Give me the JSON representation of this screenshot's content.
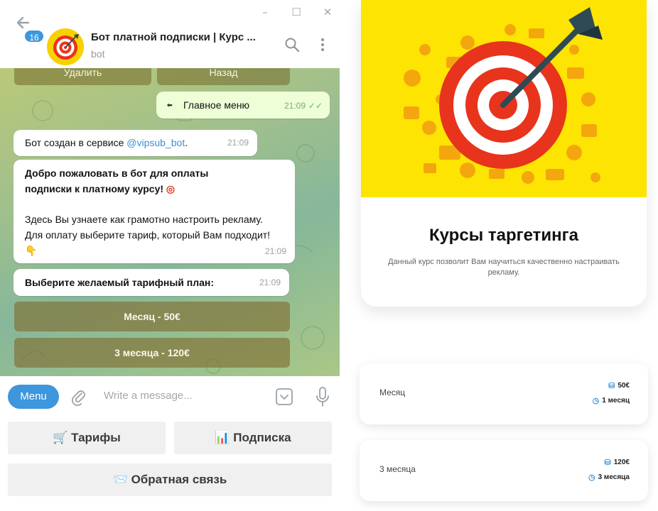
{
  "telegram": {
    "window_controls": {
      "minimize": "–",
      "maximize": "☐",
      "close": "✕"
    },
    "unread_badge": "16",
    "chat_title": "Бот платной подписки | Курс ...",
    "chat_subtitle": "bot",
    "top_buttons": [
      "Удалить",
      "Назад"
    ],
    "messages": {
      "outgoing_label": "Главное меню",
      "outgoing_time": "21:09",
      "created_prefix": "Бот создан в сервисе ",
      "created_link": "@vipsub_bot",
      "created_suffix": ".",
      "created_time": "21:09",
      "welcome_bold": "Добро пожаловать в бот для оплаты подписки к платному курсу!",
      "welcome_text": "Здесь Вы узнаете как грамотно настроить рекламу. Для оплату выберите тариф, который Вам подходит!",
      "welcome_time": "21:09",
      "choose_plan": "Выберите желаемый тарифный план:",
      "choose_time": "21:09"
    },
    "inline_buttons": [
      "Месяц - 50€",
      "3 месяца - 120€"
    ],
    "input": {
      "menu_label": "Menu",
      "placeholder": "Write a message..."
    },
    "reply_keyboard": {
      "tariffs": "Тарифы",
      "subscription": "Подписка",
      "feedback": "Обратная связь"
    }
  },
  "course": {
    "title": "Курсы таргетинга",
    "description": "Данный курс позволит Вам научиться качественно настраивать рекламу."
  },
  "plans": [
    {
      "name": "Месяц",
      "price": "50€",
      "duration": "1 месяц"
    },
    {
      "name": "3 месяца",
      "price": "120€",
      "duration": "3 месяца"
    }
  ],
  "colors": {
    "accent": "#3e96dc",
    "banner": "#fde402",
    "target_red": "#e8341c"
  }
}
